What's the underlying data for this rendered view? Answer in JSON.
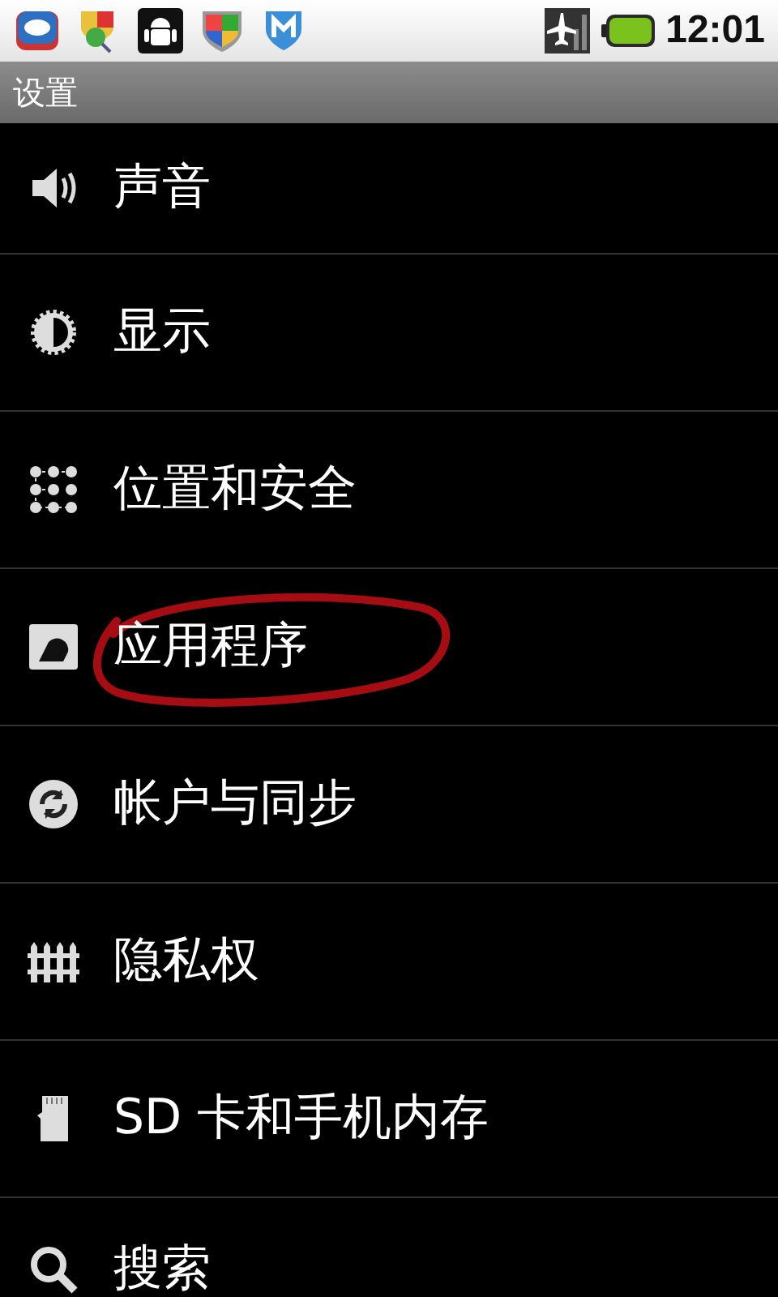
{
  "status_bar": {
    "notification_icons": [
      {
        "kind": "du"
      },
      {
        "kind": "shield-search"
      },
      {
        "kind": "android"
      },
      {
        "kind": "shield"
      },
      {
        "kind": "m-shield"
      }
    ],
    "time": "12:01"
  },
  "title_bar": {
    "title": "设置"
  },
  "settings": [
    {
      "kind": "sound",
      "label": "声音",
      "circled": false
    },
    {
      "kind": "display",
      "label": "显示",
      "circled": false
    },
    {
      "kind": "location",
      "label": "位置和安全",
      "circled": false
    },
    {
      "kind": "apps",
      "label": "应用程序",
      "circled": true
    },
    {
      "kind": "sync",
      "label": "帐户与同步",
      "circled": false
    },
    {
      "kind": "privacy",
      "label": "隐私权",
      "circled": false
    },
    {
      "kind": "sd",
      "label": "SD 卡和手机内存",
      "circled": false
    },
    {
      "kind": "search",
      "label": "搜索",
      "circled": false
    }
  ]
}
